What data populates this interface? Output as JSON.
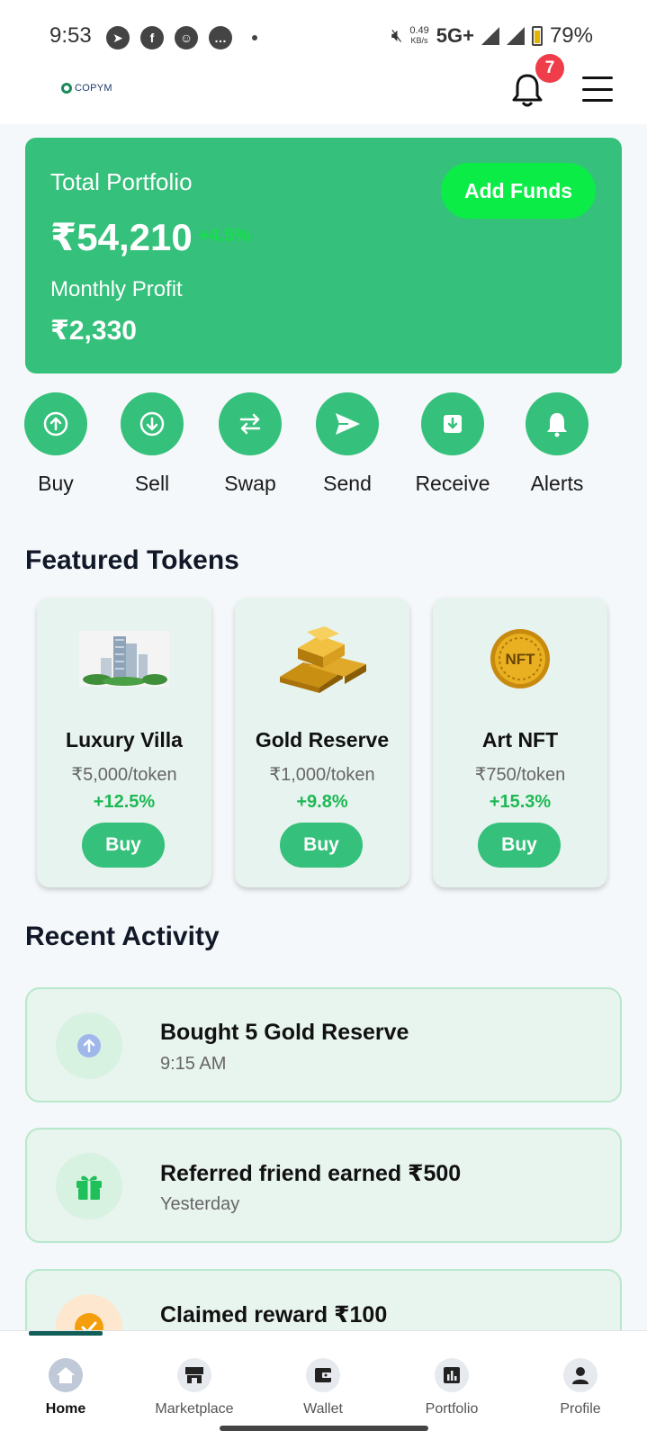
{
  "status_bar": {
    "time": "9:53",
    "net_speed": "0.49",
    "net_unit": "KB/s",
    "network": "5G+",
    "battery": "79%",
    "app_icons": [
      "telegram-icon",
      "facebook-icon",
      "snapchat-icon",
      "chat-icon"
    ]
  },
  "header": {
    "logo_text": "COPYM",
    "notification_count": "7"
  },
  "portfolio": {
    "title": "Total Portfolio",
    "value": "₹54,210",
    "change": "+4.5%",
    "monthly_label": "Monthly Profit",
    "monthly_value": "₹2,330",
    "add_funds_label": "Add Funds"
  },
  "quick_actions": [
    {
      "label": "Buy",
      "icon": "arrow-up-circle-icon"
    },
    {
      "label": "Sell",
      "icon": "arrow-down-circle-icon"
    },
    {
      "label": "Swap",
      "icon": "swap-icon"
    },
    {
      "label": "Send",
      "icon": "send-icon"
    },
    {
      "label": "Receive",
      "icon": "receive-icon"
    },
    {
      "label": "Alerts",
      "icon": "bell-icon"
    }
  ],
  "featured": {
    "title": "Featured Tokens",
    "tokens": [
      {
        "name": "Luxury Villa",
        "price": "₹5,000/token",
        "change": "+12.5%",
        "buy_label": "Buy",
        "image": "building-image"
      },
      {
        "name": "Gold Reserve",
        "price": "₹1,000/token",
        "change": "+9.8%",
        "buy_label": "Buy",
        "image": "gold-bars-image"
      },
      {
        "name": "Art NFT",
        "price": "₹750/token",
        "change": "+15.3%",
        "buy_label": "Buy",
        "image": "nft-coin-image",
        "coin_text": "NFT"
      }
    ]
  },
  "activity": {
    "title": "Recent Activity",
    "items": [
      {
        "title": "Bought 5 Gold Reserve",
        "time": "9:15 AM",
        "icon": "arrow-up-icon"
      },
      {
        "title": "Referred friend earned ₹500",
        "time": "Yesterday",
        "icon": "gift-icon"
      },
      {
        "title": "Claimed reward ₹100",
        "time": "",
        "icon": "check-icon"
      }
    ]
  },
  "bottom_nav": [
    {
      "label": "Home",
      "icon": "home-icon",
      "active": true
    },
    {
      "label": "Marketplace",
      "icon": "store-icon"
    },
    {
      "label": "Wallet",
      "icon": "wallet-icon"
    },
    {
      "label": "Portfolio",
      "icon": "chart-icon"
    },
    {
      "label": "Profile",
      "icon": "user-icon"
    }
  ],
  "colors": {
    "primary_green": "#35c07b",
    "bright_green": "#0bec46",
    "change_green": "#1db954",
    "badge_red": "#ef3e4a",
    "nav_indicator": "#115e59"
  }
}
